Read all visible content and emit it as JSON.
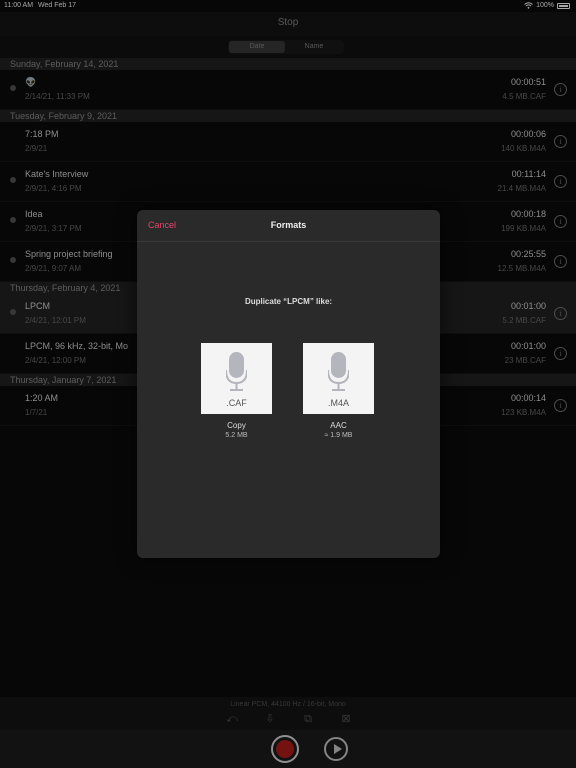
{
  "status": {
    "time": "11:00 AM",
    "date": "Wed Feb 17",
    "battery": "100%"
  },
  "nav": {
    "title": "Stop"
  },
  "segments": [
    "Date",
    "Name"
  ],
  "sections": [
    {
      "header": "Sunday, February 14, 2021",
      "rows": [
        {
          "title": "👽",
          "sub": "2/14/21, 11:33 PM",
          "dur": "00:00:51",
          "size": "4.5 MB.CAF",
          "dot": true
        }
      ]
    },
    {
      "header": "Tuesday, February 9, 2021",
      "rows": [
        {
          "title": "7:18 PM",
          "sub": "2/9/21",
          "dur": "00:00:06",
          "size": "140 KB.M4A",
          "dot": false
        },
        {
          "title": "Kate's Interview",
          "sub": "2/9/21, 4:16 PM",
          "dur": "00:11:14",
          "size": "21.4 MB.M4A",
          "dot": true
        },
        {
          "title": "Idea",
          "sub": "2/9/21, 3:17 PM",
          "dur": "00:00:18",
          "size": "199 KB.M4A",
          "dot": true
        },
        {
          "title": "Spring project briefing",
          "sub": "2/9/21, 9:07 AM",
          "dur": "00:25:55",
          "size": "12.5 MB.M4A",
          "dot": true
        }
      ]
    },
    {
      "header": "Thursday, February 4, 2021",
      "rows": [
        {
          "title": "LPCM",
          "sub": "2/4/21, 12:01 PM",
          "dur": "00:01:00",
          "size": "5.2 MB.CAF",
          "dot": true,
          "selected": true
        },
        {
          "title": "LPCM, 96 kHz, 32-bit, Mo",
          "sub": "2/4/21, 12:00 PM",
          "dur": "00:01:00",
          "size": "23 MB.CAF",
          "dot": false
        }
      ]
    },
    {
      "header": "Thursday, January 7, 2021",
      "rows": [
        {
          "title": "1:20 AM",
          "sub": "1/7/21",
          "dur": "00:00:14",
          "size": "123 KB.M4A",
          "dot": false
        }
      ]
    }
  ],
  "footer": {
    "format": "Linear PCM, 44100 Hz / 16-bit, Mono"
  },
  "modal": {
    "cancel": "Cancel",
    "title": "Formats",
    "prompt": "Duplicate “LPCM” like:",
    "options": [
      {
        "ext": ".CAF",
        "label": "Copy",
        "size": "5.2 MB"
      },
      {
        "ext": ".M4A",
        "label": "AAC",
        "size": "≈ 1.9 MB"
      }
    ]
  }
}
